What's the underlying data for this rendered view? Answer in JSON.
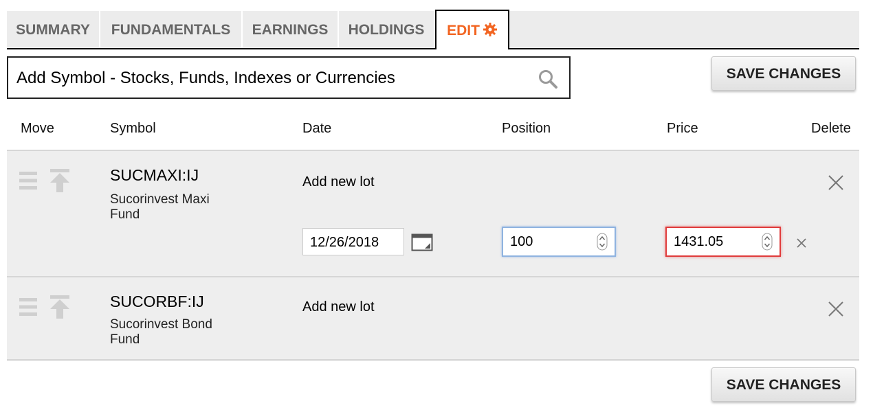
{
  "tabs": [
    {
      "label": "SUMMARY"
    },
    {
      "label": "FUNDAMENTALS"
    },
    {
      "label": "EARNINGS"
    },
    {
      "label": "HOLDINGS"
    },
    {
      "label": "EDIT",
      "active": true,
      "icon": "gear-icon"
    }
  ],
  "colors": {
    "accent": "#f26522",
    "error": "#e03b3b",
    "focus": "#8fb3e0",
    "row_bg": "#eeeeee"
  },
  "search": {
    "placeholder": "Add Symbol - Stocks, Funds, Indexes or Currencies",
    "icon": "search-icon"
  },
  "buttons": {
    "save_top": "SAVE CHANGES",
    "save_bottom": "SAVE CHANGES"
  },
  "columns": {
    "move": "Move",
    "symbol": "Symbol",
    "date": "Date",
    "position": "Position",
    "price": "Price",
    "delete": "Delete"
  },
  "rows": [
    {
      "symbol": "SUCMAXI:IJ",
      "name": "Sucorinvest Maxi Fund",
      "add_lot": "Add new lot",
      "lot": {
        "date": "12/26/2018",
        "position": "100",
        "price": "1431.05"
      }
    },
    {
      "symbol": "SUCORBF:IJ",
      "name": "Sucorinvest Bond Fund",
      "add_lot": "Add new lot"
    }
  ]
}
